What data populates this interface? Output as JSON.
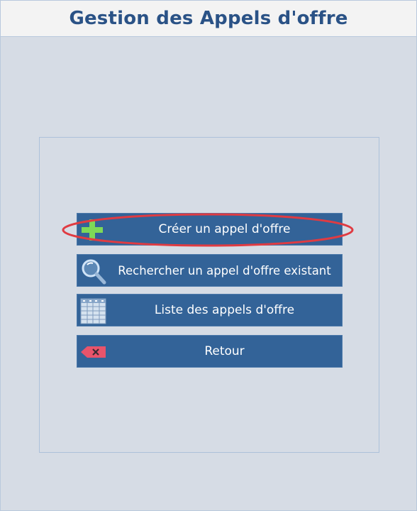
{
  "window": {
    "title": "Gestion des Appels d'offre"
  },
  "menu": {
    "items": [
      {
        "label": "Créer un appel d'offre",
        "icon": "plus-icon"
      },
      {
        "label": "Rechercher un appel d'offre existant",
        "icon": "search-icon"
      },
      {
        "label": "Liste des appels d'offre",
        "icon": "table-icon"
      },
      {
        "label": "Retour",
        "icon": "back-delete-icon"
      }
    ]
  },
  "colors": {
    "title_text": "#2a5286",
    "button_bg": "#336398",
    "background": "#d6dce5",
    "highlight_ring": "#e03b42",
    "plus_icon": "#7ed957",
    "back_icon": "#e9546b"
  }
}
